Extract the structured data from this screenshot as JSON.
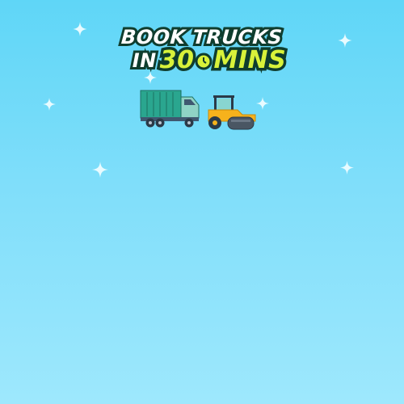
{
  "banner": {
    "headline_line1": "BOOK TRUCKS",
    "headline_in": "IN",
    "headline_number": "30",
    "headline_unit": "MINS"
  },
  "colors": {
    "sky_top": "#5fd6f7",
    "sky_bottom": "#9ee8fd",
    "text_white": "#ffffff",
    "text_accent": "#d8f23a",
    "outline": "#0f3d2e",
    "truck_body": "#2aa68f",
    "roller_body": "#f6b21c"
  },
  "icons": [
    "sparkle-icon",
    "clock-icon",
    "truck-icon",
    "road-roller-icon"
  ]
}
